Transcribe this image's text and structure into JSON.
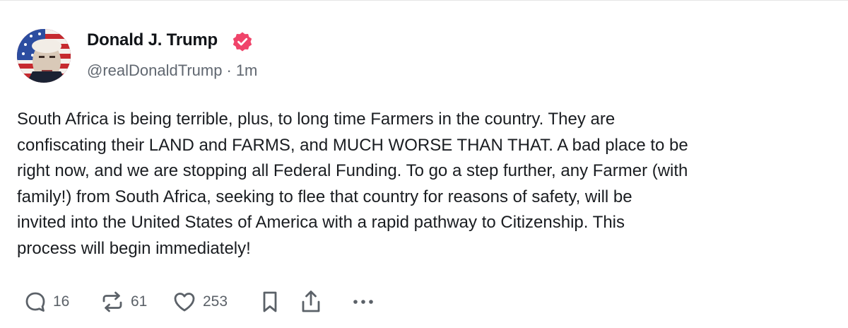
{
  "author": {
    "name": "Donald J. Trump",
    "handle": "@realDonaldTrump",
    "separator": "·",
    "time": "1m",
    "verified": true,
    "verified_color": "#f0446a"
  },
  "post": {
    "text": "South Africa is being terrible, plus, to long time Farmers in the country. They are\nconfiscating their LAND and FARMS, and MUCH WORSE THAN THAT. A bad place to be\nright now, and we are stopping all Federal Funding. To go a step further, any Farmer (with\nfamily!) from South Africa, seeking to flee that country for reasons of safety, will be\ninvited into the United States of America with a rapid pathway to Citizenship. This\nprocess will begin immediately!"
  },
  "actions": {
    "reply_count": "16",
    "repost_count": "61",
    "like_count": "253",
    "icons": [
      "reply-icon",
      "repost-icon",
      "like-icon",
      "bookmark-icon",
      "share-icon",
      "more-icon"
    ],
    "icon_color": "#5b6168"
  }
}
